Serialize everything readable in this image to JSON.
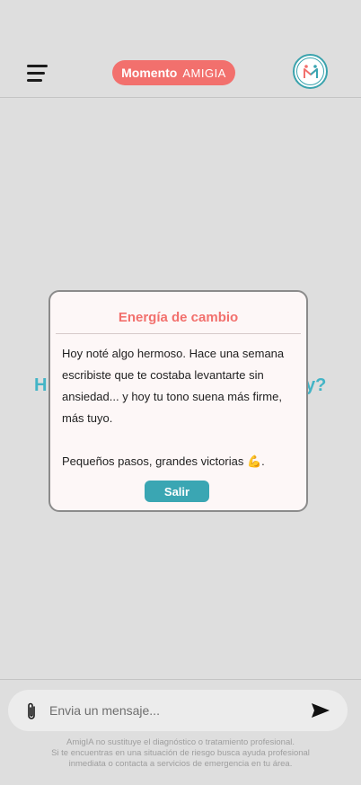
{
  "header": {
    "logo_main": "Momento",
    "logo_brand": "AMIGIA",
    "avatar_label": "M"
  },
  "main": {
    "greeting_left": "H",
    "greeting_right": "y?"
  },
  "modal": {
    "title": "Energía de cambio",
    "paragraph_1": "Hoy noté algo hermoso. Hace una semana escribiste que te costaba levantarte sin ansiedad... y hoy tu tono suena más firme, más tuyo.",
    "paragraph_2": "Pequeños pasos, grandes victorias 💪.",
    "exit_label": "Salir"
  },
  "composer": {
    "placeholder": "Envia un mensaje..."
  },
  "disclaimer": {
    "line_1": "AmigIA no sustituye el diagnóstico o tratamiento profesional.",
    "line_2": "Si te encuentras en una situación de riesgo busca ayuda profesional",
    "line_3": "inmediata o contacta a servicios de emergencia en tu área."
  },
  "colors": {
    "brand_coral": "#f2706d",
    "brand_teal": "#3aa6b3",
    "background": "#dedede"
  },
  "icons": {
    "menu": "menu-icon",
    "attach": "paperclip-icon",
    "send": "send-icon"
  }
}
